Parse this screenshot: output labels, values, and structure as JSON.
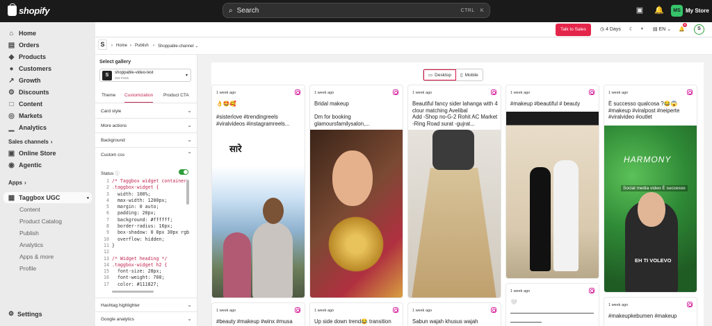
{
  "topbar": {
    "brand": "shopify",
    "search_placeholder": "Search",
    "shortcut_1": "CTRL",
    "shortcut_2": "K",
    "store_initials": "MS",
    "store_name": "My Store"
  },
  "nav": {
    "items": [
      "Home",
      "Orders",
      "Products",
      "Customers",
      "Growth",
      "Discounts",
      "Content",
      "Markets",
      "Analytics"
    ],
    "sales_channels": "Sales channels",
    "channels": [
      "Online Store",
      "Agentic"
    ],
    "apps": "Apps",
    "app_name": "Taggbox UGC",
    "app_sub": [
      "Content",
      "Product Catalog",
      "Publish",
      "Analytics",
      "Apps & more",
      "Profile"
    ],
    "settings": "Settings"
  },
  "header": {
    "talk_button": "Talk to Sales",
    "days": "4 Days",
    "lang": "EN",
    "badge": "6"
  },
  "breadcrumb": {
    "logo": "S",
    "items": [
      "Home",
      "Publish",
      "Shoppable-channel"
    ]
  },
  "panel": {
    "select_label": "Select gallery",
    "gallery_name": "shoppable-video-test",
    "gallery_sub": "315 Posts",
    "gallery_icon": "S",
    "tabs": [
      "Theme",
      "Customization",
      "Product CTA"
    ],
    "sections": [
      "Card style",
      "More actions",
      "Background",
      "Custom css"
    ],
    "status_label": "Status",
    "bottom_sections": [
      "Hashtag highlighter",
      "Google analytics"
    ]
  },
  "code": [
    {
      "n": "1",
      "t": "/* Taggbox widget container */",
      "c": "cm"
    },
    {
      "n": "2",
      "t": ".taggbox-widget {",
      "c": "sel"
    },
    {
      "n": "3",
      "t": "  width: 100%;",
      "c": ""
    },
    {
      "n": "4",
      "t": "  max-width: 1200px;",
      "c": ""
    },
    {
      "n": "5",
      "t": "  margin: 0 auto;",
      "c": ""
    },
    {
      "n": "6",
      "t": "  padding: 20px;",
      "c": ""
    },
    {
      "n": "7",
      "t": "  background: #ffffff;",
      "c": ""
    },
    {
      "n": "8",
      "t": "  border-radius: 16px;",
      "c": ""
    },
    {
      "n": "9",
      "t": "  box-shadow: 0 8px 30px rgb",
      "c": ""
    },
    {
      "n": "10",
      "t": "  overflow: hidden;",
      "c": ""
    },
    {
      "n": "11",
      "t": "}",
      "c": ""
    },
    {
      "n": "12",
      "t": "",
      "c": ""
    },
    {
      "n": "13",
      "t": "/* Widget heading */",
      "c": "cm"
    },
    {
      "n": "14",
      "t": ".taggbox-widget h2 {",
      "c": "sel"
    },
    {
      "n": "15",
      "t": "  font-size: 28px;",
      "c": ""
    },
    {
      "n": "16",
      "t": "  font-weight: 700;",
      "c": ""
    },
    {
      "n": "17",
      "t": "  color: #111827;",
      "c": ""
    }
  ],
  "view_toggle": {
    "desktop": "Desktop",
    "mobile": "Mobile"
  },
  "cards": [
    {
      "time": "1 week ago",
      "caption": "👌🤩🥰\n\n#sisterlove #trendingreels #viralvideos #instagramreels..."
    },
    {
      "time": "1 week ago",
      "caption": "Bridal makeup\n\nDm for booking glamoursfamilysalon,..."
    },
    {
      "time": "1 week ago",
      "caption": "Beautiful fancy sider lahanga with 4 clour matching Avelibal\nAdd -Shop no-G-2 Rohit AC Market -Ring Road surat -gujrat..."
    },
    {
      "time": "1 week ago",
      "caption": "#makeup #beautiful # beauty"
    },
    {
      "time": "1 week ago",
      "caption": "È successo qualcosa ?😂😱\n#makeup #viralpost #neiperte #viralvideo #outlet"
    }
  ],
  "cards_row2": [
    {
      "time": "1 week ago",
      "caption": "#beauty #makeup #winx #musa"
    },
    {
      "time": "1 week ago",
      "caption": "Up side down trend😂 transition"
    },
    {
      "time": "1 week ago",
      "caption": "Sabun wajah khusus wajah"
    },
    {
      "time": "1 week ago",
      "caption": "🤍"
    },
    {
      "time": "1 week ago",
      "caption": "#makeupkebumen #makeup"
    }
  ],
  "overlays": {
    "sare": "सारे",
    "harmony": "HARMONY",
    "social": "Social media video È successo",
    "eh": "EH TI VOLEVO"
  }
}
